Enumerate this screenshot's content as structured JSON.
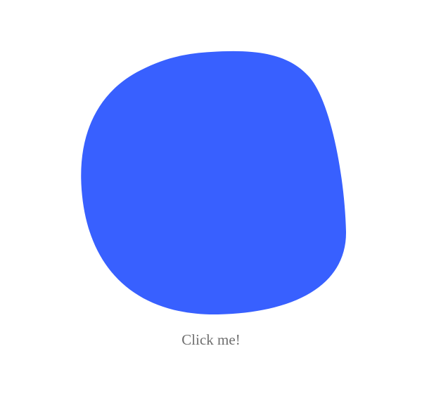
{
  "blob": {
    "icon": "blob-shape",
    "color": "#3860ff"
  },
  "label": {
    "text": "Click me!",
    "color": "#6e6e6e"
  }
}
